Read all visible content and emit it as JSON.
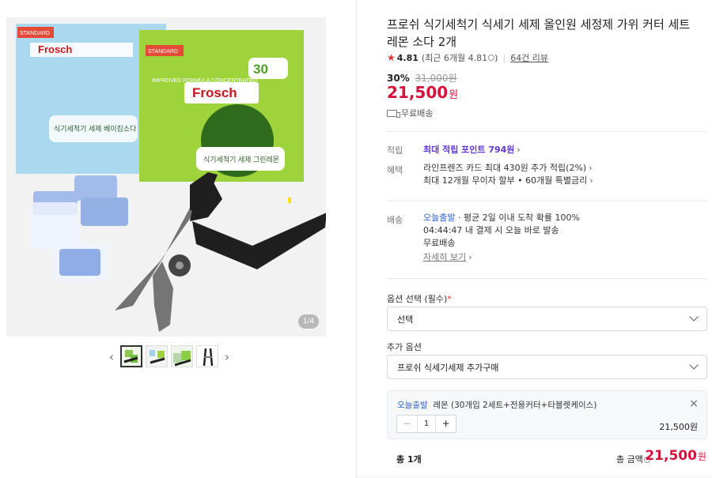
{
  "gallery": {
    "counter": "1/4",
    "thumbnails": [
      "thumbnail-1",
      "thumbnail-2",
      "thumbnail-3",
      "thumbnail-4"
    ],
    "image_text": {
      "blue_box_label": "식기세척기 세제 베이킹소다",
      "green_box_label": "식기세척기 세제 그린레몬",
      "brand": "Frosch",
      "standard_badge": "STANDARD",
      "formula": "IMPROVED FORMULA CONCENTRATED",
      "count": "30"
    }
  },
  "product": {
    "title": "프로쉬 식기세척기 식세기 세제 올인원 세정제 가위 커터 세트 레몬 소다 2개",
    "rating": "4.81",
    "rating_recent": "(최근 6개월 4.81",
    "reviews": "64건 리뷰",
    "discount_rate": "30%",
    "original_price": "31,000원",
    "price": "21,500",
    "currency": "원",
    "shipping": "무료배송"
  },
  "benefits": {
    "points_label": "적립",
    "points_value": "최대 적립 포인트 794원",
    "benefit_label": "혜택",
    "benefit_line_1": "라인프렌즈 카드 최대 430원 추가 적립(2%)",
    "benefit_line_2": "최대 12개월 무이자 할부 • 60개월 특별금리"
  },
  "delivery": {
    "label": "배송",
    "badge": "오늘출발",
    "line_1": " · 평균 2일 이내 도착 확률 100%",
    "line_2": "04:44:47  내 결제 시 오늘 바로 발송",
    "line_3": "무료배송",
    "detail": "자세히 보기"
  },
  "options": {
    "required_label": "옵션 선택 (필수)",
    "required_mark": "*",
    "required_value": "선택",
    "additional_label": "추가 옵션",
    "additional_value": "프로쉬 식세기세제 추가구매"
  },
  "selected_option": {
    "badge": "오늘출발",
    "name": "레몬 (30개입 2세트+전용커터+타블렛케이스)",
    "quantity": "1",
    "price": "21,500원",
    "close": "×",
    "minus": "−",
    "plus": "+"
  },
  "total": {
    "label": "총 1개",
    "amount_label": "총 금액",
    "amount": "21,500",
    "currency": "원"
  }
}
